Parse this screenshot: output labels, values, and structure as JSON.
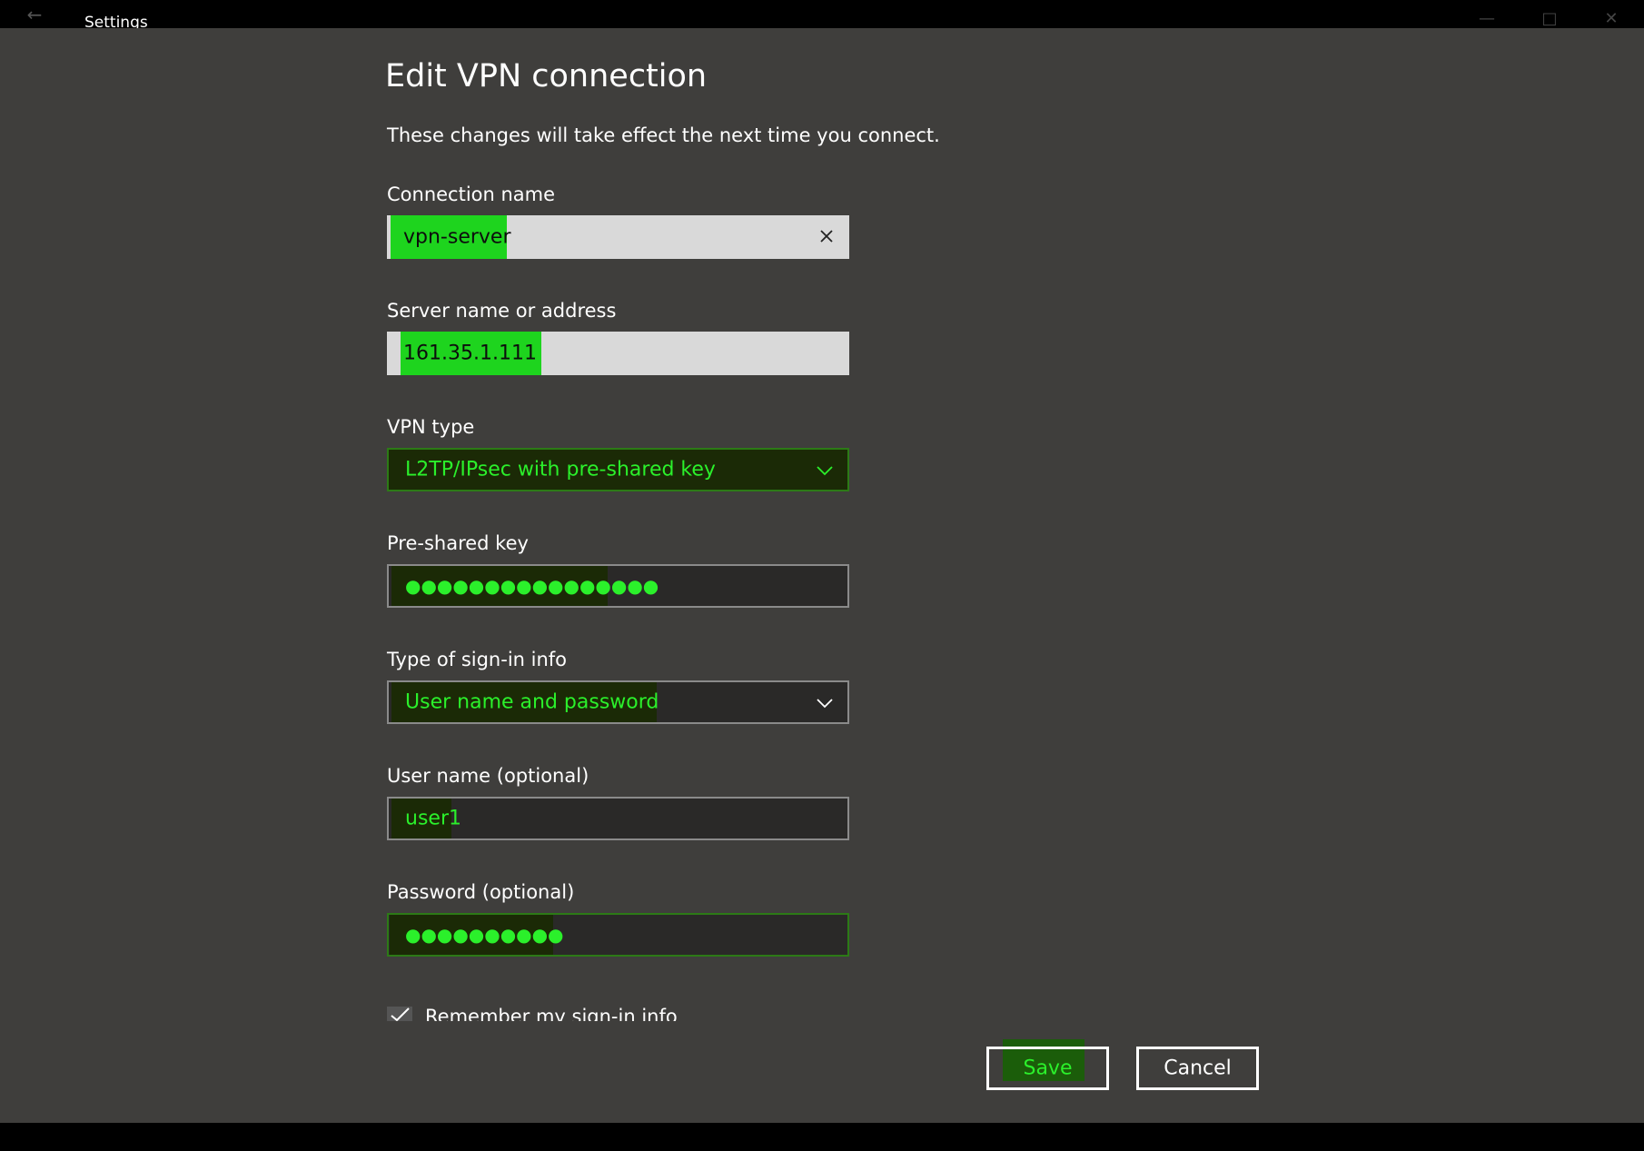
{
  "window": {
    "title": "Settings",
    "back_icon": "←",
    "minimize_icon": "—",
    "maximize_icon": "□",
    "close_icon": "✕"
  },
  "page": {
    "heading": "Edit VPN connection",
    "subtext": "These changes will take effect the next time you connect."
  },
  "fields": {
    "connection_name": {
      "label": "Connection name",
      "value": "vpn-server"
    },
    "server_address": {
      "label": "Server name or address",
      "value": "161.35.1.111"
    },
    "vpn_type": {
      "label": "VPN type",
      "value": "L2TP/IPsec with pre-shared key"
    },
    "pre_shared_key": {
      "label": "Pre-shared key",
      "value": "●●●●●●●●●●●●●●●●"
    },
    "sign_in_type": {
      "label": "Type of sign-in info",
      "value": "User name and password"
    },
    "user_name": {
      "label": "User name (optional)",
      "value": "user1"
    },
    "password": {
      "label": "Password (optional)",
      "value": "●●●●●●●●●●"
    }
  },
  "remember": {
    "label": "Remember my sign-in info",
    "checked": true
  },
  "buttons": {
    "save": "Save",
    "cancel": "Cancel"
  },
  "colors": {
    "background": "#3f3e3c",
    "highlight_bright": "#1ed41e",
    "highlight_dark": "#1b2a06",
    "text_green": "#2bf02b"
  }
}
